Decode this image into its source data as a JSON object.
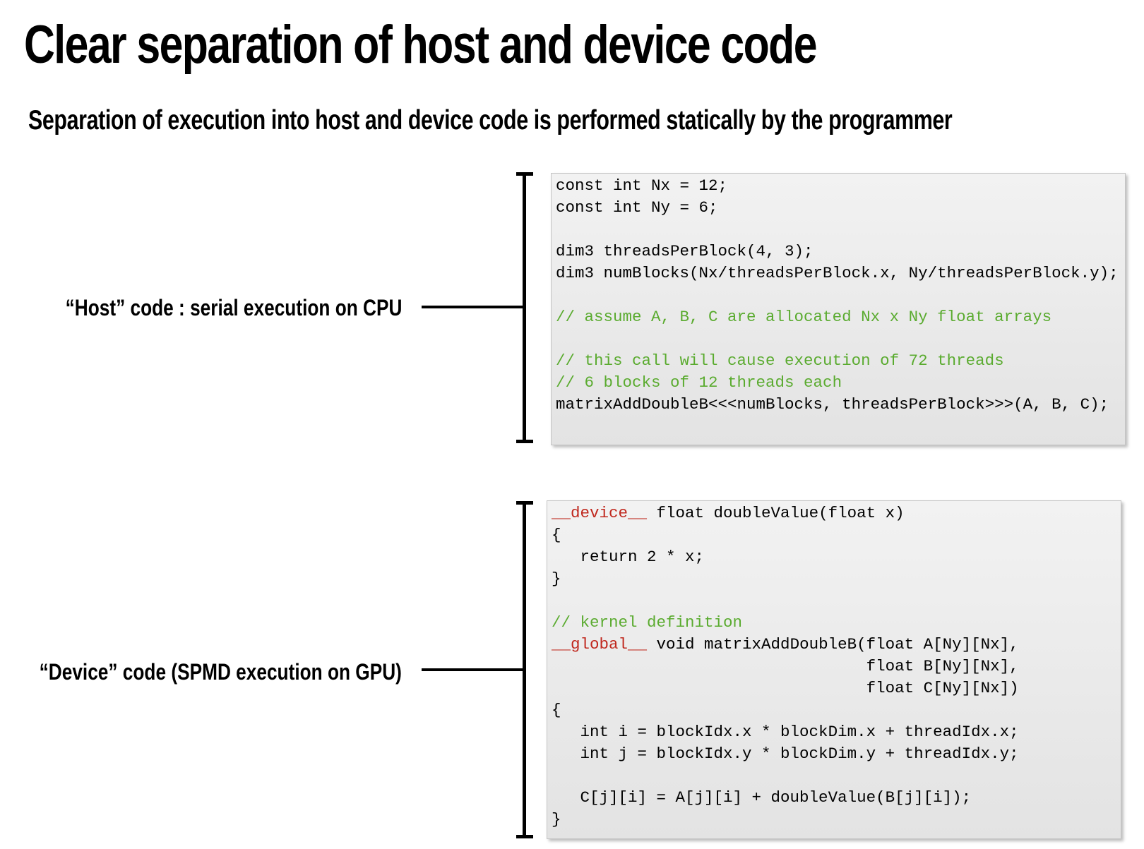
{
  "slide": {
    "title": "Clear separation of host and device code",
    "subtitle": "Separation of execution into host and device code is performed statically by the programmer",
    "host_label": "“Host” code : serial execution on CPU",
    "device_label": "“Device” code (SPMD execution on GPU)"
  },
  "host_code": {
    "lines": [
      "const int Nx = 12;",
      "const int Ny = 6;",
      "",
      "dim3 threadsPerBlock(4, 3);",
      "dim3 numBlocks(Nx/threadsPerBlock.x, Ny/threadsPerBlock.y);",
      "",
      "// assume A, B, C are allocated Nx x Ny float arrays",
      "",
      "// this call will cause execution of 72 threads",
      "// 6 blocks of 12 threads each",
      "matrixAddDoubleB<<<numBlocks, threadsPerBlock>>>(A, B, C);"
    ]
  },
  "device_code": {
    "keyword_device": "__device__",
    "keyword_global": "__global__",
    "line1_rest": " float doubleValue(float x)",
    "line2": "{",
    "line3": "   return 2 * x;",
    "line4": "}",
    "line5": "",
    "line6_comment": "// kernel definition",
    "line7_rest": " void matrixAddDoubleB(float A[Ny][Nx],",
    "line8": "                                 float B[Ny][Nx],",
    "line9": "                                 float C[Ny][Nx])",
    "line10": "{",
    "line11": "   int i = blockIdx.x * blockDim.x + threadIdx.x;",
    "line12": "   int j = blockIdx.y * blockDim.y + threadIdx.y;",
    "line13": "",
    "line14": "   C[j][i] = A[j][i] + doubleValue(B[j][i]);",
    "line15": "}"
  },
  "colors": {
    "comment": "#5aab2f",
    "keyword": "#c0281e",
    "code_background": "#ececec"
  }
}
